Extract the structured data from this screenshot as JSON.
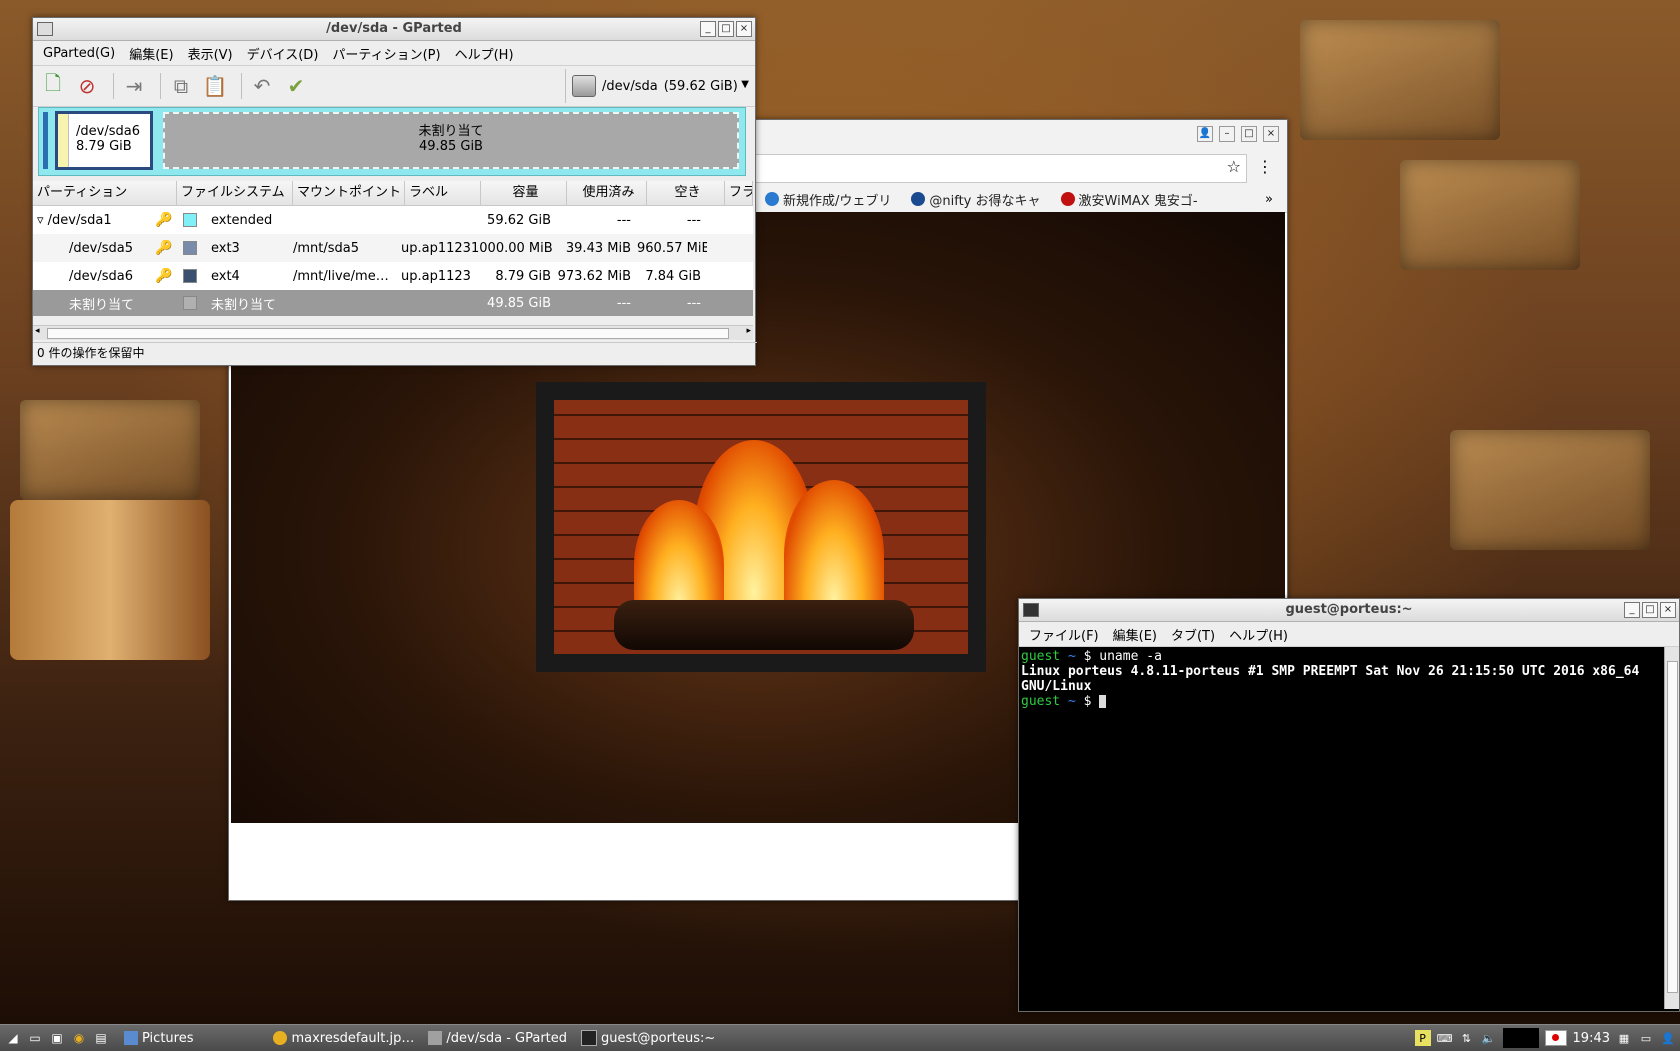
{
  "desktop": {},
  "gparted": {
    "title": "/dev/sda - GParted",
    "menu": [
      "GParted(G)",
      "編集(E)",
      "表示(V)",
      "デバイス(D)",
      "パーティション(P)",
      "ヘルプ(H)"
    ],
    "device": "/dev/sda",
    "device_size": "(59.62 GiB)",
    "graph": {
      "sda6_name": "/dev/sda6",
      "sda6_size": "8.79 GiB",
      "unallocated_label": "未割り当て",
      "unallocated_size": "49.85 GiB"
    },
    "columns": [
      "パーティション",
      "ファイルシステム",
      "マウントポイント",
      "ラベル",
      "容量",
      "使用済み",
      "空き",
      "フラ"
    ],
    "rows": [
      {
        "partition": "/dev/sda1",
        "fs": "extended",
        "mount": "",
        "label": "",
        "size": "59.62 GiB",
        "used": "---",
        "free": "---",
        "color": "#7ff0f8"
      },
      {
        "partition": "/dev/sda5",
        "fs": "ext3",
        "mount": "/mnt/sda5",
        "label": "up.ap1123",
        "size": "1000.00 MiB",
        "used": "39.43 MiB",
        "free": "960.57 MiB",
        "color": "#7a8aaa"
      },
      {
        "partition": "/dev/sda6",
        "fs": "ext4",
        "mount": "/mnt/live/me…",
        "label": "up.ap1123",
        "size": "8.79 GiB",
        "used": "973.62 MiB",
        "free": "7.84 GiB",
        "color": "#3a5070"
      },
      {
        "partition": "未割り当て",
        "fs": "未割り当て",
        "mount": "",
        "label": "",
        "size": "49.85 GiB",
        "used": "---",
        "free": "---",
        "color": "#b0b0b0"
      }
    ],
    "status": "0 件の操作を保留中"
  },
  "browser": {
    "bookmarks": [
      "新規作成/ウェブリ",
      "@nifty お得なキャ",
      "激安WiMAX 鬼安ゴ-"
    ],
    "more": "»"
  },
  "terminal": {
    "title": "guest@porteus:~",
    "menu": [
      "ファイル(F)",
      "編集(E)",
      "タブ(T)",
      "ヘルプ(H)"
    ],
    "prompt_user": "guest",
    "prompt_dir": "~",
    "prompt_symbol": "$",
    "command": "uname -a",
    "output_line1": "Linux porteus 4.8.11-porteus #1 SMP PREEMPT Sat Nov 26 21:15:50 UTC 2016 x86_64",
    "output_line2": "GNU/Linux"
  },
  "taskbar": {
    "tasks": [
      {
        "label": "Pictures"
      },
      {
        "label": "maxresdefault.jp…"
      },
      {
        "label": "/dev/sda - GParted"
      },
      {
        "label": "guest@porteus:~"
      }
    ],
    "clock": "19:43"
  }
}
